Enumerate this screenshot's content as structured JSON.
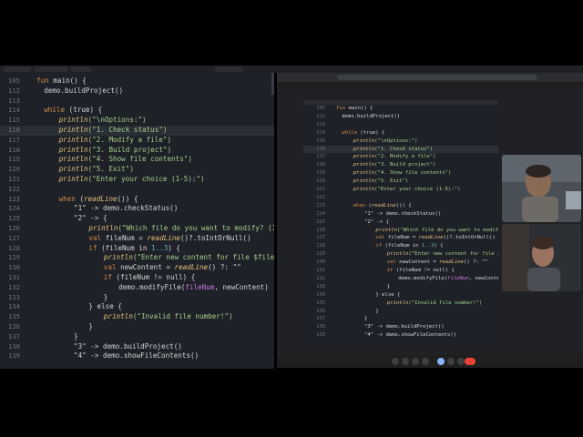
{
  "top_tabs": [
    "",
    "",
    "",
    ""
  ],
  "left_editor": {
    "highlight_line": 116,
    "rows": [
      {
        "n": "105",
        "segs": [
          {
            "t": "fun ",
            "c": "kw"
          },
          {
            "t": "main",
            "c": ""
          },
          {
            "t": "() {",
            "c": ""
          }
        ],
        "indent": 0
      },
      {
        "n": "112",
        "segs": [
          {
            "t": "demo.buildProject()",
            "c": ""
          }
        ],
        "indent": 1
      },
      {
        "n": "113",
        "segs": [],
        "indent": 0
      },
      {
        "n": "114",
        "segs": [
          {
            "t": "while ",
            "c": "kw"
          },
          {
            "t": "(true) {",
            "c": ""
          }
        ],
        "indent": 1
      },
      {
        "n": "115",
        "segs": [
          {
            "t": "println",
            "c": "fn"
          },
          {
            "t": "(\"\\nOptions:\")",
            "c": "str"
          }
        ],
        "indent": 3
      },
      {
        "n": "116",
        "segs": [
          {
            "t": "println",
            "c": "fn"
          },
          {
            "t": "(\"1. Check status\")",
            "c": "str"
          }
        ],
        "indent": 3
      },
      {
        "n": "117",
        "segs": [
          {
            "t": "println",
            "c": "fn"
          },
          {
            "t": "(\"2. Modify a file\")",
            "c": "str"
          }
        ],
        "indent": 3
      },
      {
        "n": "118",
        "segs": [
          {
            "t": "println",
            "c": "fn"
          },
          {
            "t": "(\"3. Build project\")",
            "c": "str"
          }
        ],
        "indent": 3
      },
      {
        "n": "119",
        "segs": [
          {
            "t": "println",
            "c": "fn"
          },
          {
            "t": "(\"4. Show file contents\")",
            "c": "str"
          }
        ],
        "indent": 3
      },
      {
        "n": "120",
        "segs": [
          {
            "t": "println",
            "c": "fn"
          },
          {
            "t": "(\"5. Exit\")",
            "c": "str"
          }
        ],
        "indent": 3
      },
      {
        "n": "121",
        "segs": [
          {
            "t": "println",
            "c": "fn"
          },
          {
            "t": "(\"Enter your choice (1-5):\")",
            "c": "str"
          }
        ],
        "indent": 3
      },
      {
        "n": "122",
        "segs": [],
        "indent": 0
      },
      {
        "n": "123",
        "segs": [
          {
            "t": "when ",
            "c": "kw"
          },
          {
            "t": "(",
            "c": ""
          },
          {
            "t": "readLine",
            "c": "fn"
          },
          {
            "t": "()) {",
            "c": ""
          }
        ],
        "indent": 3
      },
      {
        "n": "124",
        "segs": [
          {
            "t": "\"1\" -> demo.checkStatus()",
            "c": ""
          }
        ],
        "indent": 5
      },
      {
        "n": "125",
        "segs": [
          {
            "t": "\"2\" -> {",
            "c": ""
          }
        ],
        "indent": 5
      },
      {
        "n": "126",
        "segs": [
          {
            "t": "println",
            "c": "fn"
          },
          {
            "t": "(\"Which file do you want to modify? (1-3):\")",
            "c": "str"
          }
        ],
        "indent": 7
      },
      {
        "n": "127",
        "segs": [
          {
            "t": "val ",
            "c": "kw"
          },
          {
            "t": "fileNum = ",
            "c": ""
          },
          {
            "t": "readLine",
            "c": "fn"
          },
          {
            "t": "()?.toIntOrNull()",
            "c": ""
          }
        ],
        "indent": 7
      },
      {
        "n": "128",
        "segs": [
          {
            "t": "if ",
            "c": "kw"
          },
          {
            "t": "(fileNum in ",
            "c": ""
          },
          {
            "t": "1..3",
            "c": "num"
          },
          {
            "t": ") {",
            "c": ""
          }
        ],
        "indent": 7
      },
      {
        "n": "129",
        "segs": [
          {
            "t": "println",
            "c": "fn"
          },
          {
            "t": "(\"Enter new content for file $fileNum:\")",
            "c": "str"
          }
        ],
        "indent": 9
      },
      {
        "n": "130",
        "segs": [
          {
            "t": "val ",
            "c": "kw"
          },
          {
            "t": "newContent = ",
            "c": ""
          },
          {
            "t": "readLine",
            "c": "fn"
          },
          {
            "t": "() ?: \"\"",
            "c": ""
          }
        ],
        "indent": 9
      },
      {
        "n": "131",
        "segs": [
          {
            "t": "if ",
            "c": "kw"
          },
          {
            "t": "(fileNum != null) {",
            "c": ""
          }
        ],
        "indent": 9
      },
      {
        "n": "132",
        "segs": [
          {
            "t": "demo.modifyFile(",
            "c": ""
          },
          {
            "t": "fileNum",
            "c": "prop"
          },
          {
            "t": ", newContent)",
            "c": ""
          }
        ],
        "indent": 11
      },
      {
        "n": "133",
        "segs": [
          {
            "t": "}",
            "c": ""
          }
        ],
        "indent": 9
      },
      {
        "n": "134",
        "segs": [
          {
            "t": "} else {",
            "c": ""
          }
        ],
        "indent": 7
      },
      {
        "n": "135",
        "segs": [
          {
            "t": "println",
            "c": "fn"
          },
          {
            "t": "(\"Invalid file number!\")",
            "c": "str"
          }
        ],
        "indent": 9
      },
      {
        "n": "136",
        "segs": [
          {
            "t": "}",
            "c": ""
          }
        ],
        "indent": 7
      },
      {
        "n": "137",
        "segs": [
          {
            "t": "}",
            "c": ""
          }
        ],
        "indent": 5
      },
      {
        "n": "138",
        "segs": [
          {
            "t": "\"3\" -> demo.buildProject()",
            "c": ""
          }
        ],
        "indent": 5
      },
      {
        "n": "139",
        "segs": [
          {
            "t": "\"4\" -> demo.showFileContents()",
            "c": ""
          }
        ],
        "indent": 5
      }
    ]
  },
  "shared_editor": {
    "highlight_line": 116,
    "rows": [
      {
        "n": "105",
        "segs": [
          {
            "t": "fun ",
            "c": "kw"
          },
          {
            "t": "main() {",
            "c": ""
          }
        ],
        "indent": 0
      },
      {
        "n": "112",
        "segs": [
          {
            "t": "demo.buildProject()",
            "c": ""
          }
        ],
        "indent": 1
      },
      {
        "n": "113",
        "segs": [],
        "indent": 0
      },
      {
        "n": "114",
        "segs": [
          {
            "t": "while ",
            "c": "kw"
          },
          {
            "t": "(true) {",
            "c": ""
          }
        ],
        "indent": 1
      },
      {
        "n": "115",
        "segs": [
          {
            "t": "println",
            "c": "fn"
          },
          {
            "t": "(\"\\nOptions:\")",
            "c": "str"
          }
        ],
        "indent": 3
      },
      {
        "n": "116",
        "segs": [
          {
            "t": "println",
            "c": "fn"
          },
          {
            "t": "(\"1. Check status\")",
            "c": "str"
          }
        ],
        "indent": 3
      },
      {
        "n": "117",
        "segs": [
          {
            "t": "println",
            "c": "fn"
          },
          {
            "t": "(\"2. Modify a file\")",
            "c": "str"
          }
        ],
        "indent": 3
      },
      {
        "n": "118",
        "segs": [
          {
            "t": "println",
            "c": "fn"
          },
          {
            "t": "(\"3. Build project\")",
            "c": "str"
          }
        ],
        "indent": 3
      },
      {
        "n": "119",
        "segs": [
          {
            "t": "println",
            "c": "fn"
          },
          {
            "t": "(\"4. Show file contents\")",
            "c": "str"
          }
        ],
        "indent": 3
      },
      {
        "n": "120",
        "segs": [
          {
            "t": "println",
            "c": "fn"
          },
          {
            "t": "(\"5. Exit\")",
            "c": "str"
          }
        ],
        "indent": 3
      },
      {
        "n": "121",
        "segs": [
          {
            "t": "println",
            "c": "fn"
          },
          {
            "t": "(\"Enter your choice (1-5):\")",
            "c": "str"
          }
        ],
        "indent": 3
      },
      {
        "n": "122",
        "segs": [],
        "indent": 0
      },
      {
        "n": "123",
        "segs": [
          {
            "t": "when ",
            "c": "kw"
          },
          {
            "t": "(",
            "c": ""
          },
          {
            "t": "readLine",
            "c": "fn"
          },
          {
            "t": "()) {",
            "c": ""
          }
        ],
        "indent": 3
      },
      {
        "n": "124",
        "segs": [
          {
            "t": "\"1\" -> demo.checkStatus()",
            "c": ""
          }
        ],
        "indent": 5
      },
      {
        "n": "125",
        "segs": [
          {
            "t": "\"2\" -> {",
            "c": ""
          }
        ],
        "indent": 5
      },
      {
        "n": "126",
        "segs": [
          {
            "t": "println",
            "c": "fn"
          },
          {
            "t": "(\"Which file do you want to modify? (1-3):\")",
            "c": "str"
          }
        ],
        "indent": 7
      },
      {
        "n": "127",
        "segs": [
          {
            "t": "val ",
            "c": "kw"
          },
          {
            "t": "fileNum = ",
            "c": ""
          },
          {
            "t": "readLine",
            "c": "fn"
          },
          {
            "t": "()?.toIntOrNull()",
            "c": ""
          }
        ],
        "indent": 7
      },
      {
        "n": "128",
        "segs": [
          {
            "t": "if ",
            "c": "kw"
          },
          {
            "t": "(fileNum in ",
            "c": ""
          },
          {
            "t": "1..3",
            "c": "num"
          },
          {
            "t": ") {",
            "c": ""
          }
        ],
        "indent": 7
      },
      {
        "n": "129",
        "segs": [
          {
            "t": "println",
            "c": "fn"
          },
          {
            "t": "(\"Enter new content for file $fileNum:\")",
            "c": "str"
          }
        ],
        "indent": 9
      },
      {
        "n": "130",
        "segs": [
          {
            "t": "val ",
            "c": "kw"
          },
          {
            "t": "newContent = ",
            "c": ""
          },
          {
            "t": "readLine",
            "c": "fn"
          },
          {
            "t": "() ?: \"\"",
            "c": ""
          }
        ],
        "indent": 9
      },
      {
        "n": "131",
        "segs": [
          {
            "t": "if ",
            "c": "kw"
          },
          {
            "t": "(fileNum != null) {",
            "c": ""
          }
        ],
        "indent": 9
      },
      {
        "n": "132",
        "segs": [
          {
            "t": "demo.modifyFile(",
            "c": ""
          },
          {
            "t": "fileNum",
            "c": "prop"
          },
          {
            "t": ", newContent)",
            "c": ""
          }
        ],
        "indent": 11
      },
      {
        "n": "133",
        "segs": [
          {
            "t": "}",
            "c": ""
          }
        ],
        "indent": 9
      },
      {
        "n": "134",
        "segs": [
          {
            "t": "} else {",
            "c": ""
          }
        ],
        "indent": 7
      },
      {
        "n": "135",
        "segs": [
          {
            "t": "println",
            "c": "fn"
          },
          {
            "t": "(\"Invalid file number!\")",
            "c": "str"
          }
        ],
        "indent": 9
      },
      {
        "n": "136",
        "segs": [
          {
            "t": "}",
            "c": ""
          }
        ],
        "indent": 7
      },
      {
        "n": "137",
        "segs": [
          {
            "t": "}",
            "c": ""
          }
        ],
        "indent": 5
      },
      {
        "n": "138",
        "segs": [
          {
            "t": "\"3\" -> demo.buildProject()",
            "c": ""
          }
        ],
        "indent": 5
      },
      {
        "n": "139",
        "segs": [
          {
            "t": "\"4\" -> demo.showFileContents()",
            "c": ""
          }
        ],
        "indent": 5
      }
    ]
  },
  "meeting": {
    "participants": [
      {
        "name": "",
        "icon": "participant-video-icon"
      },
      {
        "name": "",
        "icon": "participant-video-icon"
      }
    ],
    "controls": [
      "mic-icon",
      "camera-icon",
      "captions-icon",
      "emoji-icon",
      "present-icon",
      "raise-hand-icon",
      "more-icon",
      "end-call-icon"
    ]
  },
  "colors": {
    "editor_bg": "#1e2127",
    "keyword": "#d08a4b",
    "function": "#e6c07b",
    "string": "#a8d08d",
    "number": "#56b6c2",
    "end_call": "#ea4335"
  }
}
